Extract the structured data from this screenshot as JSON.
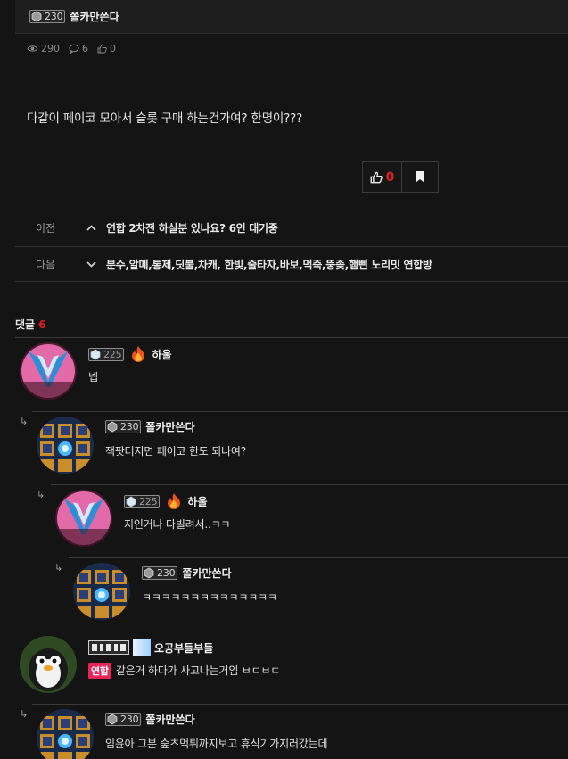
{
  "post": {
    "author": {
      "level": "230",
      "name": "쫄카만쓴다"
    },
    "stats": {
      "views": "290",
      "comments": "6",
      "likes": "0"
    },
    "body": "다같이 페이코 모아서 슬롯 구매 하는건가여? 한명이???",
    "vote_count": "0"
  },
  "nav": {
    "prev": {
      "label": "이전",
      "title": "연합 2차전 하실분 있나요? 6인 대기중"
    },
    "next": {
      "label": "다음",
      "title": "분수,알메,통제,딧불,차캐, 한빛,줄타자,바보,먹죽,뚱좆,햄삔 노리밋 연합방"
    }
  },
  "comments_header": {
    "label": "댓글",
    "count": "6"
  },
  "comments": [
    {
      "level": "225",
      "name": "하울",
      "text": "넵"
    },
    {
      "level": "230",
      "name": "쫄카만쓴다",
      "text": "잭팟터지면 페이코 한도 되나여?"
    },
    {
      "level": "225",
      "name": "하울",
      "text": "지인거나 다빌려서..ㅋㅋ"
    },
    {
      "level": "230",
      "name": "쫄카만쓴다",
      "text": "ㅋㅋㅋㅋㅋㅋㅋㅋㅋㅋㅋㅋㅋㅋ"
    },
    {
      "name": "오공부들부들",
      "tag": "연합",
      "text": "같은거 하다가 사고나는거임 ㅂㄷㅂㄷ"
    },
    {
      "level": "230",
      "name": "쫄카만쓴다",
      "text": "임윤아 그분 숲츠먹튀까지보고 휴식기가지러갔는데"
    }
  ],
  "colors": {
    "accent": "#e02020",
    "union_badge": "#e8245a",
    "background": "#141414"
  }
}
